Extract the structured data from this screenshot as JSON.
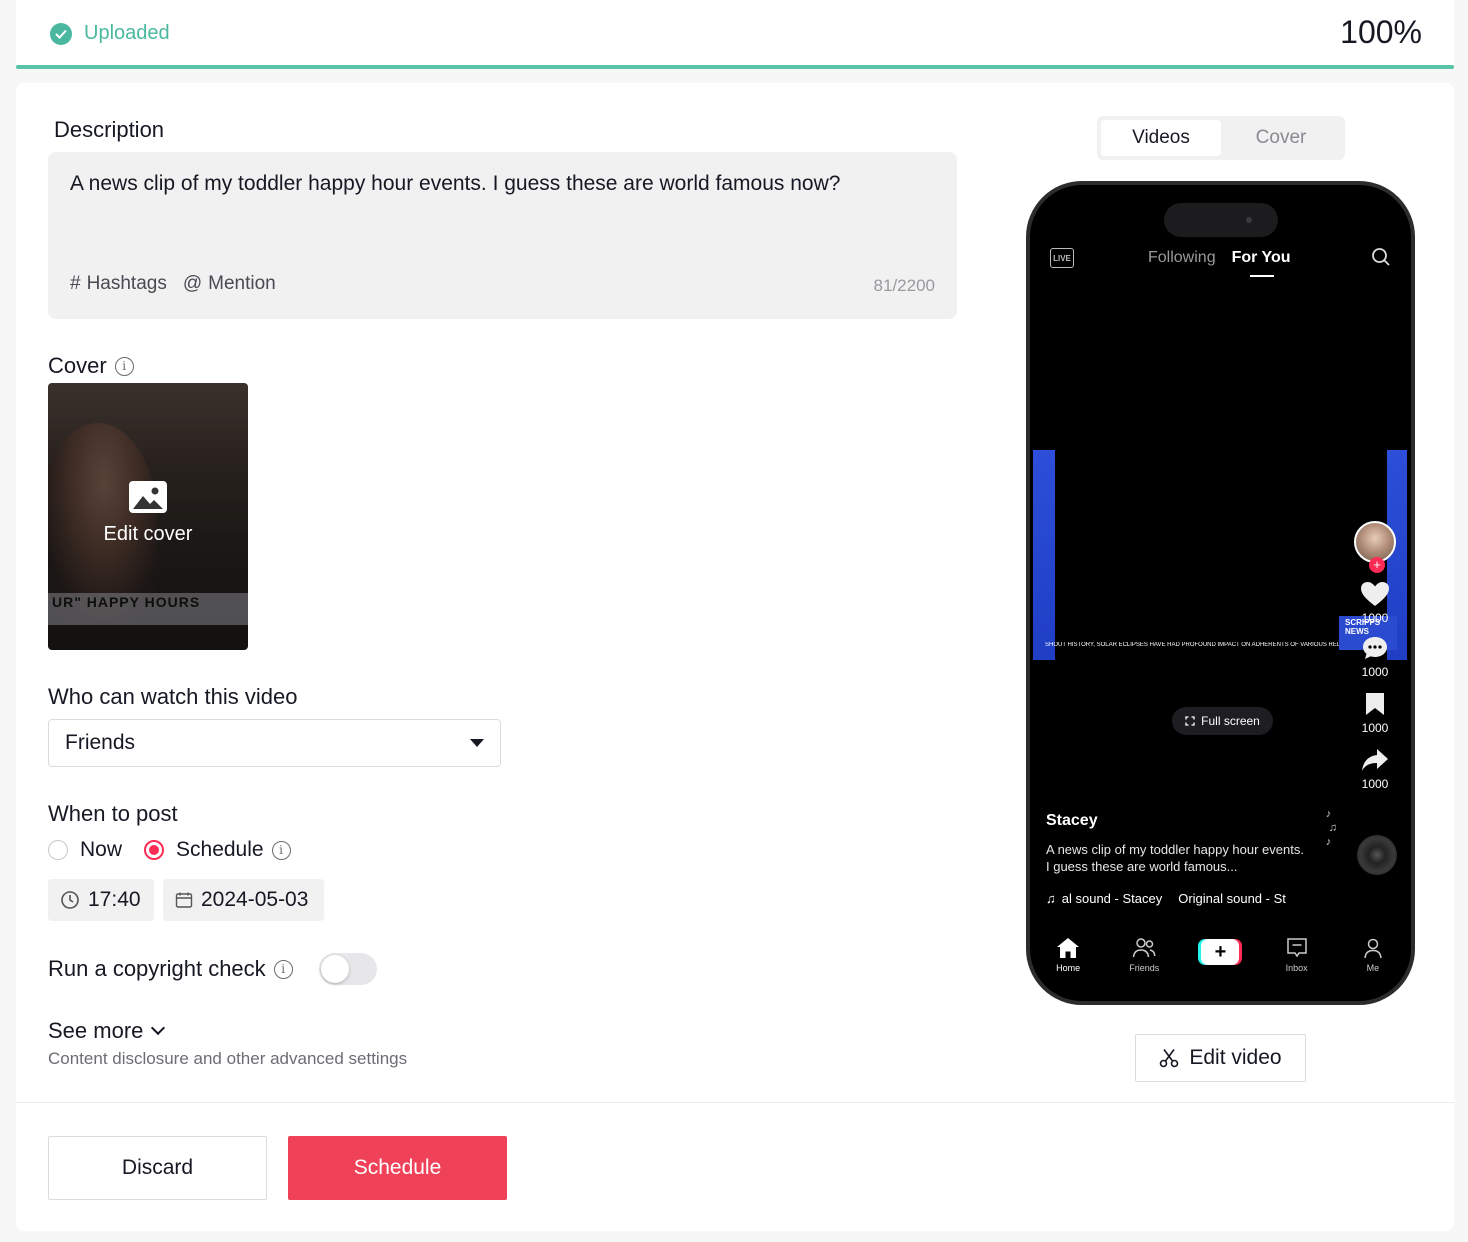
{
  "upload": {
    "status": "Uploaded",
    "percent_label": "100%",
    "progress": 1.0
  },
  "description": {
    "label": "Description",
    "text": "A news clip of my toddler happy hour events. I guess these are world famous now?",
    "hashtags_label": "Hashtags",
    "mention_label": "Mention",
    "count": "81/2200"
  },
  "cover": {
    "label": "Cover",
    "edit_label": "Edit cover",
    "caption": "UR\" HAPPY HOURS"
  },
  "visibility": {
    "label": "Who can watch this video",
    "selected": "Friends"
  },
  "post_time": {
    "label": "When to post",
    "option_now": "Now",
    "option_schedule": "Schedule",
    "selected": "Schedule",
    "time": "17:40",
    "date": "2024-05-03"
  },
  "copyright": {
    "label": "Run a copyright check",
    "enabled": false
  },
  "see_more": {
    "label": "See more",
    "subtitle": "Content disclosure and other advanced settings"
  },
  "actions": {
    "discard": "Discard",
    "schedule": "Schedule"
  },
  "preview": {
    "tab_videos": "Videos",
    "tab_cover": "Cover",
    "active_tab": "Videos",
    "live": "LIVE",
    "tab_following": "Following",
    "tab_foryou": "For You",
    "ticker": "SHOUT HISTORY, SOLAR ECLIPSES HAVE HAD PROFOUND IMPACT ON ADHERENTS OF VARIOUS RELIGIONS",
    "brand": "SCRIPPS NEWS",
    "full_screen": "Full screen",
    "likes": "1000",
    "comments": "1000",
    "saves": "1000",
    "shares": "1000",
    "username": "Stacey",
    "caption": "A news clip of my toddler happy hour events. I guess these are world famous...",
    "sound_1": "al sound - Stacey",
    "sound_2": "Original sound - St",
    "nav_home": "Home",
    "nav_friends": "Friends",
    "nav_inbox": "Inbox",
    "nav_me": "Me"
  },
  "edit_video": "Edit video",
  "colors": {
    "accent": "#fe2c55",
    "success": "#4ab89f",
    "schedule_button": "#ef4259"
  }
}
